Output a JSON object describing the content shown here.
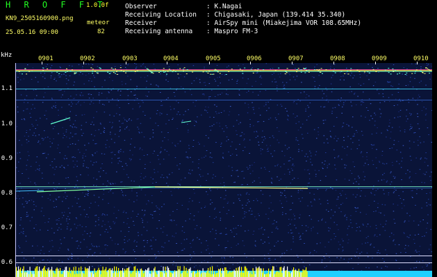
{
  "header": {
    "title": "H R O F F T",
    "version": "1.0.0f",
    "filename": "KN9_2505160900.png",
    "meteor_label": "meteor",
    "timestamp": "25.05.16 09:00",
    "meteor_count": "82"
  },
  "metadata": [
    {
      "key": "Observer",
      "value": ": K.Nagai"
    },
    {
      "key": "Receiving Location",
      "value": ": Chigasaki, Japan (139.414 35.340)"
    },
    {
      "key": "Receiver",
      "value": ": AirSpy mini (Miakejima VOR 108.65MHz)"
    },
    {
      "key": "Receiving antenna",
      "value": ": Maspro FM-3"
    }
  ],
  "y_axis": {
    "unit": "kHz",
    "ticks": [
      "1.1",
      "1.0",
      "0.9",
      "0.8",
      "0.7",
      "0.6"
    ]
  },
  "x_axis": {
    "ticks": [
      "0901",
      "0902",
      "0903",
      "0904",
      "0905",
      "0906",
      "0907",
      "0908",
      "0909",
      "0910"
    ]
  },
  "colors": {
    "background": "#000000",
    "title": "#22ff22",
    "labels": "#ffff66",
    "spectrum_bg": "#0a1438"
  }
}
